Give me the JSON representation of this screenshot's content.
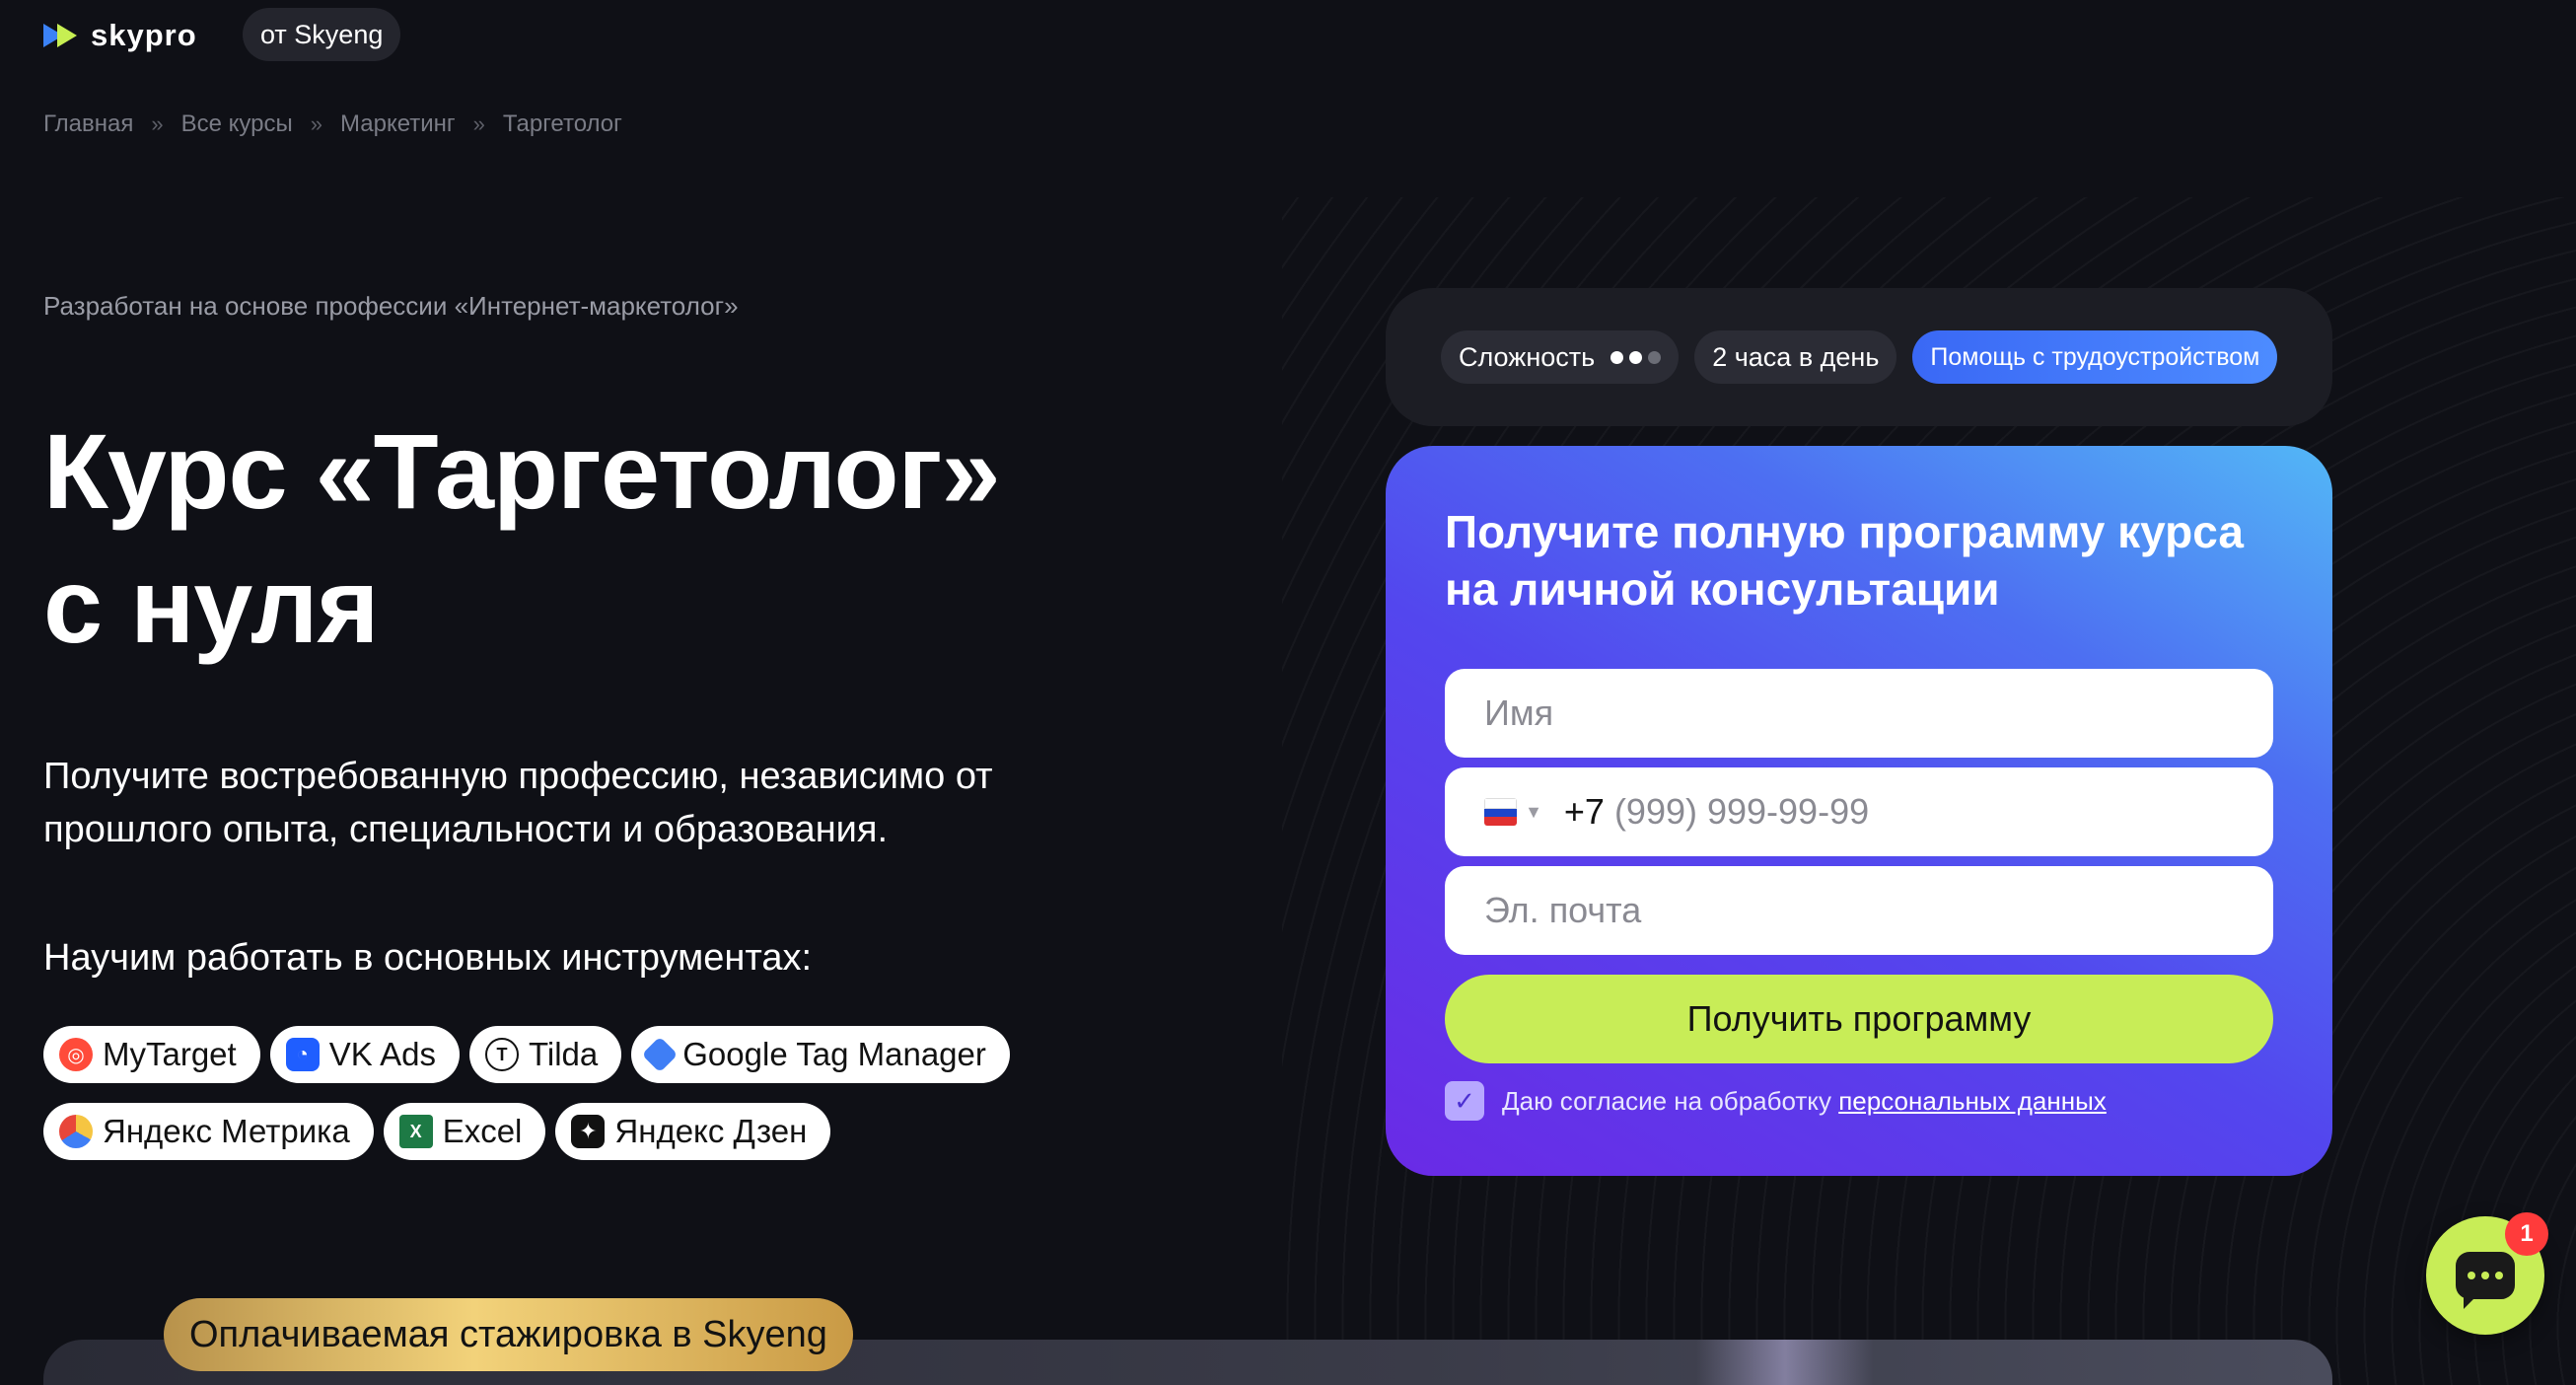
{
  "header": {
    "logo_text": "skypro",
    "from_label": "от Skyeng"
  },
  "breadcrumb": {
    "items": [
      "Главная",
      "Все курсы",
      "Маркетинг",
      "Таргетолог"
    ],
    "separator": "»"
  },
  "hero": {
    "subtitle": "Разработан на основе профессии «Интернет-маркетолог»",
    "title_line1": "Курс «Таргетолог»",
    "title_line2": "с нуля",
    "description": "Получите востребованную профессию, независимо от прошлого опыта, специальности и образования.",
    "tools_heading": "Научим работать в основных инструментах:"
  },
  "tools": [
    {
      "label": "MyTarget",
      "icon": "mytarget-icon",
      "color": "#ff4b3a"
    },
    {
      "label": "VK Ads",
      "icon": "vk-ads-icon",
      "color": "#1f5eff"
    },
    {
      "label": "Tilda",
      "icon": "tilda-icon",
      "color": "#ffffff"
    },
    {
      "label": "Google Tag Manager",
      "icon": "google-tag-manager-icon",
      "color": "#3f7ef5"
    },
    {
      "label": "Яндекс Метрика",
      "icon": "yandex-metrika-icon",
      "color": "#f5c542"
    },
    {
      "label": "Excel",
      "icon": "excel-icon",
      "color": "#1d7a45"
    },
    {
      "label": "Яндекс Дзен",
      "icon": "yandex-zen-icon",
      "color": "#111111"
    }
  ],
  "badges": {
    "difficulty_label": "Сложность",
    "difficulty_level": 2,
    "difficulty_max": 3,
    "hours_label": "2 часа в день",
    "job_help_label": "Помощь с трудоустройством"
  },
  "form": {
    "title": "Получите полную программу курса на личной консультации",
    "name_placeholder": "Имя",
    "phone_prefix": "+7",
    "phone_placeholder": "(999) 999-99-99",
    "email_placeholder": "Эл. почта",
    "submit_label": "Получить программу",
    "consent_text": "Даю согласие на обработку",
    "consent_link": "персональных данных",
    "consent_checked": true
  },
  "chat": {
    "unread_count": "1"
  },
  "banner": {
    "internship_label": "Оплачиваемая стажировка в Skyeng"
  },
  "colors": {
    "background": "#0f1016",
    "accent_green": "#c8ed57",
    "accent_blue": "#3a68f5",
    "gradient_start": "#53b7f6",
    "gradient_end": "#6a2ae6"
  }
}
